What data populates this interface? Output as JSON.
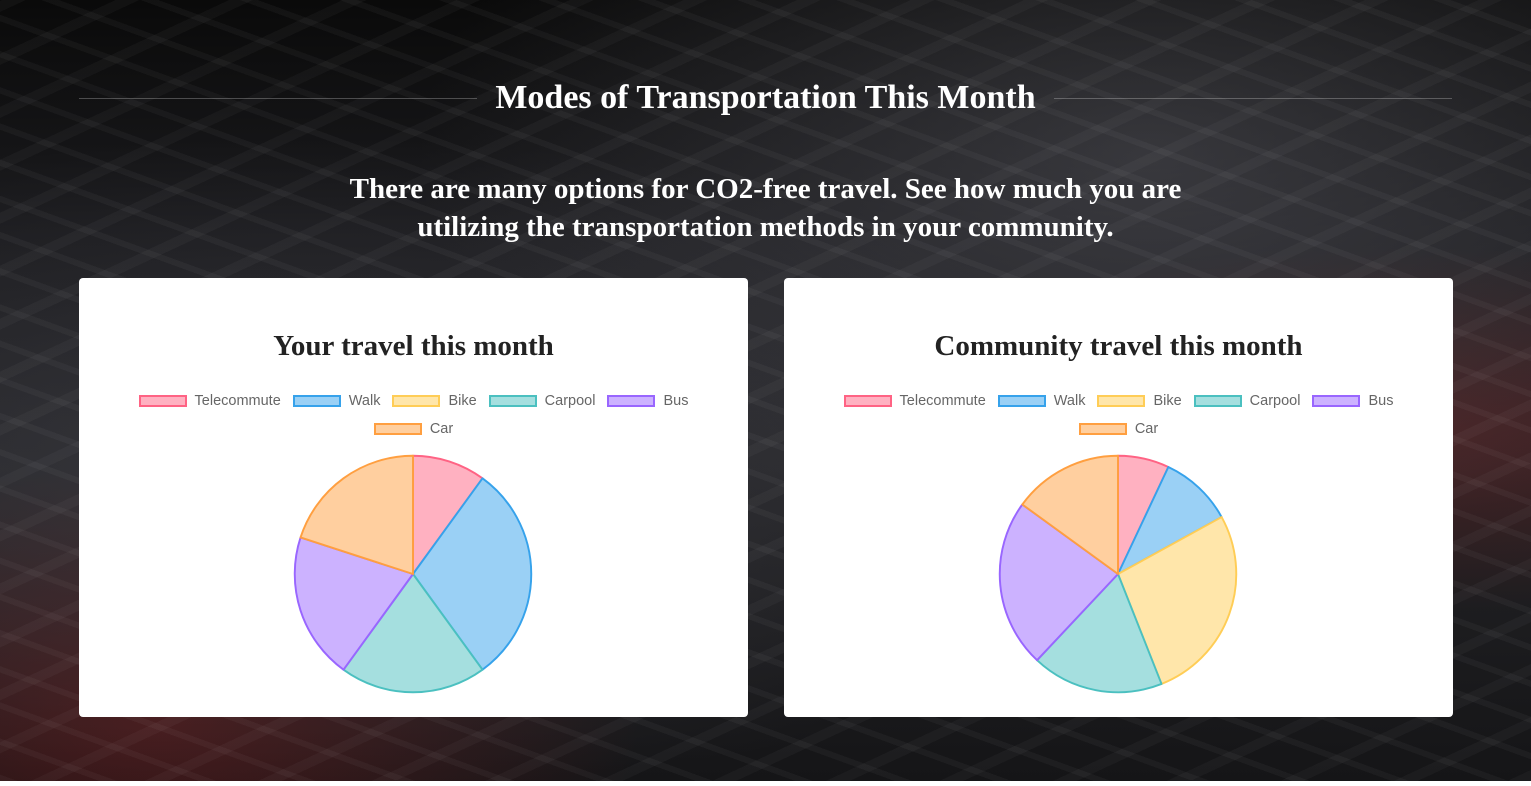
{
  "page": {
    "title": "Modes of Transportation This Month",
    "subtitle": "There are many options for CO2-free travel. See how much you are utilizing the transportation methods in your community."
  },
  "legend_colors": {
    "Telecommute": {
      "fill": "#ffb1c1",
      "stroke": "#ff6384"
    },
    "Walk": {
      "fill": "#9ad0f5",
      "stroke": "#36a2eb"
    },
    "Bike": {
      "fill": "#ffe6aa",
      "stroke": "#ffcd56"
    },
    "Carpool": {
      "fill": "#a5dfdf",
      "stroke": "#4bc0c0"
    },
    "Bus": {
      "fill": "#ccb2ff",
      "stroke": "#9966ff"
    },
    "Car": {
      "fill": "#ffcf9f",
      "stroke": "#ff9f40"
    }
  },
  "chart_data": [
    {
      "type": "pie",
      "title": "Your travel this month",
      "legend_position": "top",
      "categories": [
        "Telecommute",
        "Walk",
        "Bike",
        "Carpool",
        "Bus",
        "Car"
      ],
      "values": [
        10,
        30,
        0,
        20,
        20,
        20
      ]
    },
    {
      "type": "pie",
      "title": "Community travel this month",
      "legend_position": "top",
      "categories": [
        "Telecommute",
        "Walk",
        "Bike",
        "Carpool",
        "Bus",
        "Car"
      ],
      "values": [
        7,
        10,
        27,
        18,
        23,
        15
      ]
    }
  ]
}
